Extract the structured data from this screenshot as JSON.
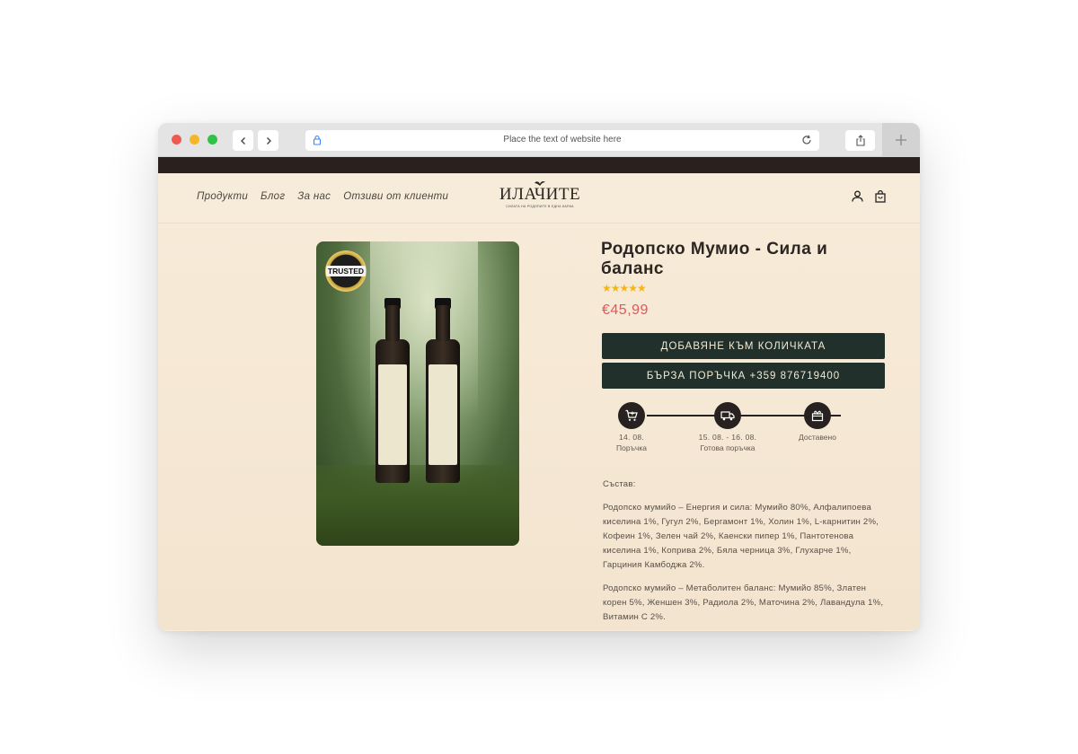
{
  "browser": {
    "url_placeholder": "Place the text of website here"
  },
  "nav": {
    "items": [
      "Продукти",
      "Блог",
      "За нас",
      "Отзиви от клиенти"
    ]
  },
  "logo": {
    "title": "ИЛАЧИТЕ",
    "tagline": "СИЛАТА НА РОДОПИТЕ В ЕДНА КАПКА"
  },
  "product": {
    "badge": "TRUSTED",
    "title": "Родопско Мумио - Сила и баланс",
    "rating": 5,
    "stars": "★★★★★",
    "price": "€45,99",
    "add_to_cart": "ДОБАВЯНЕ КЪМ КОЛИЧКАТА",
    "quick_order": "БЪРЗА ПОРЪЧКА +359 876719400"
  },
  "timeline": {
    "steps": [
      {
        "date": "14. 08.",
        "label": "Поръчка"
      },
      {
        "date": "15. 08. - 16. 08.",
        "label": "Готова поръчка"
      },
      {
        "date": "",
        "label": "Доставено"
      }
    ]
  },
  "description": {
    "heading": "Състав:",
    "paragraphs": [
      "Родопско мумийо – Енергия и сила: Мумийо 80%, Алфалипоева киселина 1%, Гугул 2%, Бергамонт 1%, Холин 1%, L-карнитин 2%, Кофеин 1%, Зелен чай 2%, Каенски пипер 1%, Пантотенова киселина 1%, Коприва 2%, Бяла черница 3%, Глухарче 1%, Гарциния Камбоджа 2%.",
      "Родопско мумийо – Метаболитен баланс: Мумийо 85%, Златен корен 5%, Женшен 3%, Радиола 2%, Маточина 2%, Лавандула 1%, Витамин С 2%."
    ]
  },
  "colors": {
    "background": "#f7ecda",
    "top_strip": "#2a201e",
    "button": "#21302a",
    "price": "#e2575b",
    "stars": "#f2b51a"
  }
}
